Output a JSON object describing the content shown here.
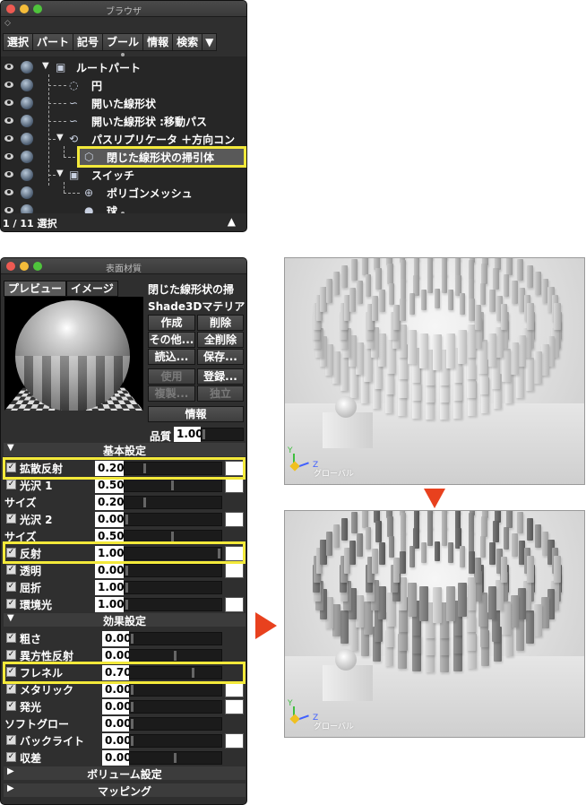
{
  "browser": {
    "title": "ブラウザ",
    "tabs": [
      "選択",
      "パート",
      "記号",
      "ブール",
      "情報",
      "検索"
    ],
    "more": "▼",
    "tree": [
      {
        "label": "ルートパート",
        "icon": "part-icon"
      },
      {
        "label": "円",
        "icon": "circle-icon"
      },
      {
        "label": "開いた線形状",
        "icon": "line-icon"
      },
      {
        "label": "開いた線形状 :移動パス",
        "icon": "line-icon"
      },
      {
        "label": "パスリプリケータ ＋方向コン",
        "icon": "replicator-icon"
      },
      {
        "label": "閉じた線形状の掃引体",
        "icon": "sweep-icon"
      },
      {
        "label": "スイッチ",
        "icon": "part-icon"
      },
      {
        "label": "ポリゴンメッシュ",
        "icon": "mesh-icon"
      },
      {
        "label": "球",
        "icon": "sphere-icon"
      }
    ],
    "status": "1 / 11 選択",
    "up": "▲"
  },
  "material": {
    "title": "表面材質",
    "preview_tab": "プレビュー",
    "image_tab": "イメージ",
    "name": "閉じた線形状の掃",
    "material_type": "Shade3Dマテリア",
    "buttons": {
      "create": "作成",
      "delete": "削除",
      "other": "その他...",
      "delete_all": "全削除",
      "load": "読込...",
      "save": "保存...",
      "use": "使用",
      "register": "登録...",
      "duplicate": "複製...",
      "independent": "独立",
      "info": "情報"
    },
    "quality_label": "品質",
    "quality_value": "1.00",
    "basic_section": "基本設定",
    "effect_section": "効果設定",
    "volume_section": "ボリューム設定",
    "mapping_section": "マッピング",
    "basic": [
      {
        "label": "拡散反射",
        "value": "0.20",
        "checked": true,
        "level": 0.2,
        "swatch": true
      },
      {
        "label": "光沢 1",
        "value": "0.50",
        "checked": true,
        "level": 0.5,
        "swatch": true
      },
      {
        "label": "サイズ",
        "value": "0.20",
        "checked": false,
        "level": 0.2,
        "swatch": false
      },
      {
        "label": "光沢 2",
        "value": "0.00",
        "checked": true,
        "level": 0.0,
        "swatch": true
      },
      {
        "label": "サイズ",
        "value": "0.50",
        "checked": false,
        "level": 0.5,
        "swatch": false
      },
      {
        "label": "反射",
        "value": "1.00",
        "checked": true,
        "level": 1.0,
        "swatch": true
      },
      {
        "label": "透明",
        "value": "0.00",
        "checked": true,
        "level": 0.0,
        "swatch": true
      },
      {
        "label": "屈折",
        "value": "1.00",
        "checked": true,
        "level": 0.0,
        "swatch": false
      },
      {
        "label": "環境光",
        "value": "1.00",
        "checked": true,
        "level": 0.0,
        "swatch": true
      }
    ],
    "effects": [
      {
        "label": "粗さ",
        "value": "0.00",
        "checked": true,
        "level": 0.0,
        "swatch": false
      },
      {
        "label": "異方性反射",
        "value": "0.00",
        "checked": true,
        "level": 0.5,
        "swatch": false
      },
      {
        "label": "フレネル",
        "value": "0.70",
        "checked": true,
        "level": 0.7,
        "swatch": false
      },
      {
        "label": "メタリック",
        "value": "0.00",
        "checked": true,
        "level": 0.0,
        "swatch": true
      },
      {
        "label": "発光",
        "value": "0.00",
        "checked": true,
        "level": 0.0,
        "swatch": true
      },
      {
        "label": "ソフトグロー",
        "value": "0.00",
        "checked": false,
        "level": 0.0,
        "swatch": false
      },
      {
        "label": "バックライト",
        "value": "0.00",
        "checked": true,
        "level": 0.0,
        "swatch": true
      },
      {
        "label": "収差",
        "value": "0.00",
        "checked": true,
        "level": 0.5,
        "swatch": false
      }
    ]
  },
  "render": {
    "global_label": "グローバル",
    "axis_y": "Y",
    "axis_z": "Z"
  },
  "colors": {
    "highlight": "#f3e93a",
    "arrow": "#e8411e"
  }
}
